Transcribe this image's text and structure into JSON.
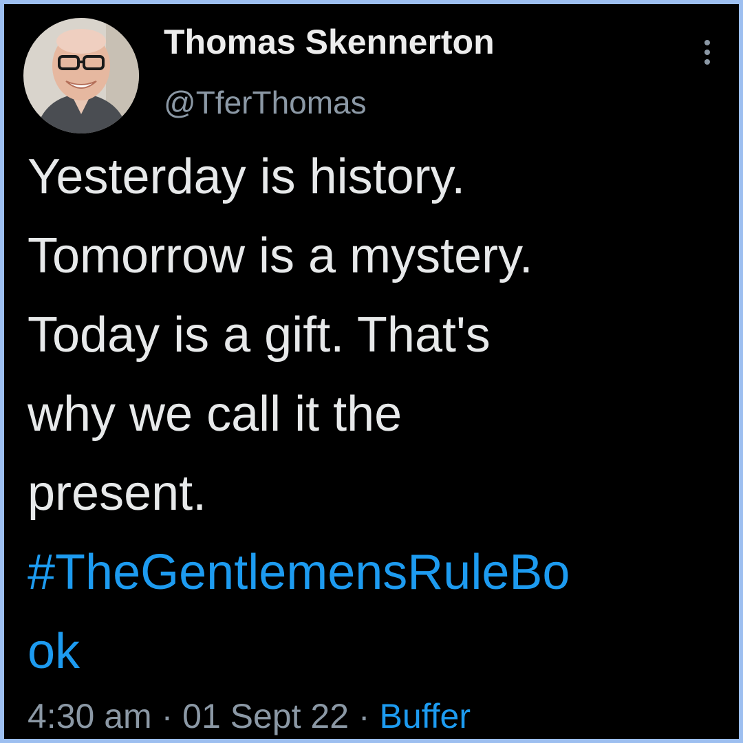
{
  "author": {
    "display_name": "Thomas Skennerton",
    "handle": "@TferThomas"
  },
  "tweet": {
    "lines": [
      "Yesterday is history.",
      "Tomorrow is a mystery.",
      "Today is a gift. That's",
      "why we call it the",
      "present."
    ],
    "hashtag_lines": [
      "#TheGentlemensRuleBo",
      "ok"
    ]
  },
  "meta": {
    "time": "4:30 am",
    "separator": "·",
    "date": "01 Sept 22",
    "source": "Buffer"
  },
  "icons": {
    "more": "more-vertical-icon"
  },
  "colors": {
    "background": "#000000",
    "frame_border": "#9dbff0",
    "text_primary": "#e7e9ea",
    "text_secondary": "#8b98a5",
    "link": "#1d9bf0"
  }
}
